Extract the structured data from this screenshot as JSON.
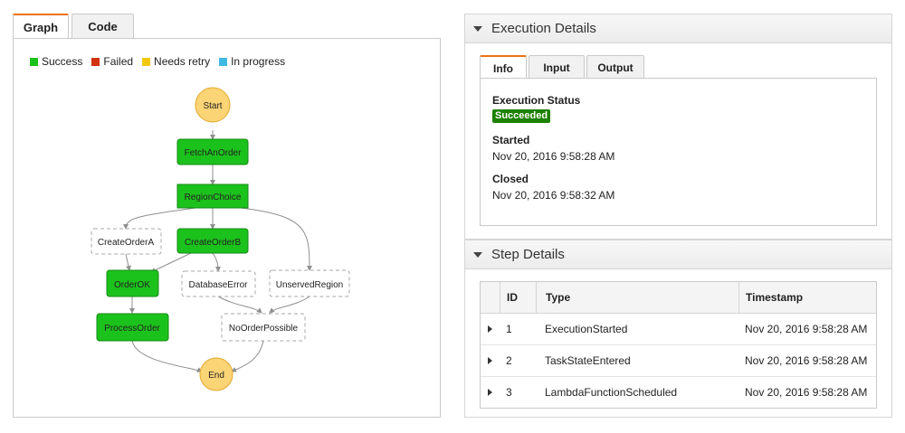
{
  "left_tabs": [
    {
      "label": "Graph",
      "active": true
    },
    {
      "label": "Code",
      "active": false
    }
  ],
  "legend": [
    {
      "label": "Success",
      "color": "#1cc21c"
    },
    {
      "label": "Failed",
      "color": "#d13212"
    },
    {
      "label": "Needs retry",
      "color": "#f2c80f"
    },
    {
      "label": "In progress",
      "color": "#3fb9e3"
    }
  ],
  "graph": {
    "nodes": {
      "start": "Start",
      "fetch": "FetchAnOrder",
      "region": "RegionChoice",
      "create_a": "CreateOrderA",
      "create_b": "CreateOrderB",
      "order_ok": "OrderOK",
      "db_error": "DatabaseError",
      "unserved": "UnservedRegion",
      "process": "ProcessOrder",
      "no_order": "NoOrderPossible",
      "end": "End"
    },
    "colors": {
      "success_fill": "#1cc21c",
      "success_border": "#168a16",
      "terminal_fill": "#fbd476",
      "terminal_border": "#e3a92a",
      "edge": "#8f8f8f"
    }
  },
  "execution_details": {
    "header": "Execution Details",
    "tabs": [
      {
        "label": "Info",
        "active": true
      },
      {
        "label": "Input",
        "active": false
      },
      {
        "label": "Output",
        "active": false
      }
    ],
    "status_label": "Execution Status",
    "status_value": "Succeeded",
    "started_label": "Started",
    "started_value": "Nov 20, 2016 9:58:28 AM",
    "closed_label": "Closed",
    "closed_value": "Nov 20, 2016 9:58:32 AM"
  },
  "step_details": {
    "header": "Step Details",
    "columns": [
      "ID",
      "Type",
      "Timestamp"
    ],
    "rows": [
      {
        "id": "1",
        "type": "ExecutionStarted",
        "timestamp": "Nov 20, 2016 9:58:28 AM"
      },
      {
        "id": "2",
        "type": "TaskStateEntered",
        "timestamp": "Nov 20, 2016 9:58:28 AM"
      },
      {
        "id": "3",
        "type": "LambdaFunctionScheduled",
        "timestamp": "Nov 20, 2016 9:58:28 AM"
      }
    ]
  }
}
